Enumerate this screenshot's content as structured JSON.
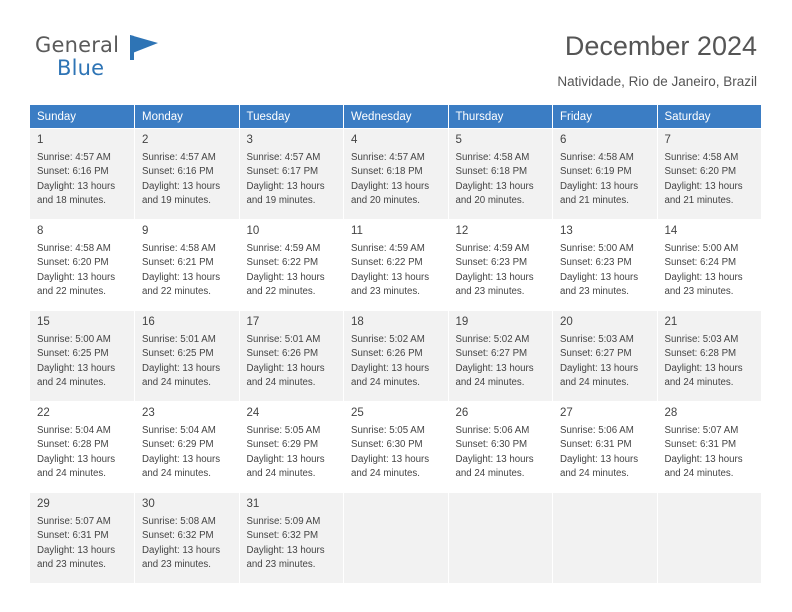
{
  "logo": {
    "word1": "General",
    "word2": "Blue",
    "flag_icon": "blue-flag-icon"
  },
  "header": {
    "title": "December 2024",
    "location": "Natividade, Rio de Janeiro, Brazil"
  },
  "calendar": {
    "weekdays": [
      "Sunday",
      "Monday",
      "Tuesday",
      "Wednesday",
      "Thursday",
      "Friday",
      "Saturday"
    ],
    "accent_color": "#3b7dc4",
    "shade_color": "#f2f2f2",
    "weeks": [
      [
        {
          "day": "1",
          "sunrise": "Sunrise: 4:57 AM",
          "sunset": "Sunset: 6:16 PM",
          "daylight1": "Daylight: 13 hours",
          "daylight2": "and 18 minutes."
        },
        {
          "day": "2",
          "sunrise": "Sunrise: 4:57 AM",
          "sunset": "Sunset: 6:16 PM",
          "daylight1": "Daylight: 13 hours",
          "daylight2": "and 19 minutes."
        },
        {
          "day": "3",
          "sunrise": "Sunrise: 4:57 AM",
          "sunset": "Sunset: 6:17 PM",
          "daylight1": "Daylight: 13 hours",
          "daylight2": "and 19 minutes."
        },
        {
          "day": "4",
          "sunrise": "Sunrise: 4:57 AM",
          "sunset": "Sunset: 6:18 PM",
          "daylight1": "Daylight: 13 hours",
          "daylight2": "and 20 minutes."
        },
        {
          "day": "5",
          "sunrise": "Sunrise: 4:58 AM",
          "sunset": "Sunset: 6:18 PM",
          "daylight1": "Daylight: 13 hours",
          "daylight2": "and 20 minutes."
        },
        {
          "day": "6",
          "sunrise": "Sunrise: 4:58 AM",
          "sunset": "Sunset: 6:19 PM",
          "daylight1": "Daylight: 13 hours",
          "daylight2": "and 21 minutes."
        },
        {
          "day": "7",
          "sunrise": "Sunrise: 4:58 AM",
          "sunset": "Sunset: 6:20 PM",
          "daylight1": "Daylight: 13 hours",
          "daylight2": "and 21 minutes."
        }
      ],
      [
        {
          "day": "8",
          "sunrise": "Sunrise: 4:58 AM",
          "sunset": "Sunset: 6:20 PM",
          "daylight1": "Daylight: 13 hours",
          "daylight2": "and 22 minutes."
        },
        {
          "day": "9",
          "sunrise": "Sunrise: 4:58 AM",
          "sunset": "Sunset: 6:21 PM",
          "daylight1": "Daylight: 13 hours",
          "daylight2": "and 22 minutes."
        },
        {
          "day": "10",
          "sunrise": "Sunrise: 4:59 AM",
          "sunset": "Sunset: 6:22 PM",
          "daylight1": "Daylight: 13 hours",
          "daylight2": "and 22 minutes."
        },
        {
          "day": "11",
          "sunrise": "Sunrise: 4:59 AM",
          "sunset": "Sunset: 6:22 PM",
          "daylight1": "Daylight: 13 hours",
          "daylight2": "and 23 minutes."
        },
        {
          "day": "12",
          "sunrise": "Sunrise: 4:59 AM",
          "sunset": "Sunset: 6:23 PM",
          "daylight1": "Daylight: 13 hours",
          "daylight2": "and 23 minutes."
        },
        {
          "day": "13",
          "sunrise": "Sunrise: 5:00 AM",
          "sunset": "Sunset: 6:23 PM",
          "daylight1": "Daylight: 13 hours",
          "daylight2": "and 23 minutes."
        },
        {
          "day": "14",
          "sunrise": "Sunrise: 5:00 AM",
          "sunset": "Sunset: 6:24 PM",
          "daylight1": "Daylight: 13 hours",
          "daylight2": "and 23 minutes."
        }
      ],
      [
        {
          "day": "15",
          "sunrise": "Sunrise: 5:00 AM",
          "sunset": "Sunset: 6:25 PM",
          "daylight1": "Daylight: 13 hours",
          "daylight2": "and 24 minutes."
        },
        {
          "day": "16",
          "sunrise": "Sunrise: 5:01 AM",
          "sunset": "Sunset: 6:25 PM",
          "daylight1": "Daylight: 13 hours",
          "daylight2": "and 24 minutes."
        },
        {
          "day": "17",
          "sunrise": "Sunrise: 5:01 AM",
          "sunset": "Sunset: 6:26 PM",
          "daylight1": "Daylight: 13 hours",
          "daylight2": "and 24 minutes."
        },
        {
          "day": "18",
          "sunrise": "Sunrise: 5:02 AM",
          "sunset": "Sunset: 6:26 PM",
          "daylight1": "Daylight: 13 hours",
          "daylight2": "and 24 minutes."
        },
        {
          "day": "19",
          "sunrise": "Sunrise: 5:02 AM",
          "sunset": "Sunset: 6:27 PM",
          "daylight1": "Daylight: 13 hours",
          "daylight2": "and 24 minutes."
        },
        {
          "day": "20",
          "sunrise": "Sunrise: 5:03 AM",
          "sunset": "Sunset: 6:27 PM",
          "daylight1": "Daylight: 13 hours",
          "daylight2": "and 24 minutes."
        },
        {
          "day": "21",
          "sunrise": "Sunrise: 5:03 AM",
          "sunset": "Sunset: 6:28 PM",
          "daylight1": "Daylight: 13 hours",
          "daylight2": "and 24 minutes."
        }
      ],
      [
        {
          "day": "22",
          "sunrise": "Sunrise: 5:04 AM",
          "sunset": "Sunset: 6:28 PM",
          "daylight1": "Daylight: 13 hours",
          "daylight2": "and 24 minutes."
        },
        {
          "day": "23",
          "sunrise": "Sunrise: 5:04 AM",
          "sunset": "Sunset: 6:29 PM",
          "daylight1": "Daylight: 13 hours",
          "daylight2": "and 24 minutes."
        },
        {
          "day": "24",
          "sunrise": "Sunrise: 5:05 AM",
          "sunset": "Sunset: 6:29 PM",
          "daylight1": "Daylight: 13 hours",
          "daylight2": "and 24 minutes."
        },
        {
          "day": "25",
          "sunrise": "Sunrise: 5:05 AM",
          "sunset": "Sunset: 6:30 PM",
          "daylight1": "Daylight: 13 hours",
          "daylight2": "and 24 minutes."
        },
        {
          "day": "26",
          "sunrise": "Sunrise: 5:06 AM",
          "sunset": "Sunset: 6:30 PM",
          "daylight1": "Daylight: 13 hours",
          "daylight2": "and 24 minutes."
        },
        {
          "day": "27",
          "sunrise": "Sunrise: 5:06 AM",
          "sunset": "Sunset: 6:31 PM",
          "daylight1": "Daylight: 13 hours",
          "daylight2": "and 24 minutes."
        },
        {
          "day": "28",
          "sunrise": "Sunrise: 5:07 AM",
          "sunset": "Sunset: 6:31 PM",
          "daylight1": "Daylight: 13 hours",
          "daylight2": "and 24 minutes."
        }
      ],
      [
        {
          "day": "29",
          "sunrise": "Sunrise: 5:07 AM",
          "sunset": "Sunset: 6:31 PM",
          "daylight1": "Daylight: 13 hours",
          "daylight2": "and 23 minutes."
        },
        {
          "day": "30",
          "sunrise": "Sunrise: 5:08 AM",
          "sunset": "Sunset: 6:32 PM",
          "daylight1": "Daylight: 13 hours",
          "daylight2": "and 23 minutes."
        },
        {
          "day": "31",
          "sunrise": "Sunrise: 5:09 AM",
          "sunset": "Sunset: 6:32 PM",
          "daylight1": "Daylight: 13 hours",
          "daylight2": "and 23 minutes."
        },
        {
          "day": "",
          "sunrise": "",
          "sunset": "",
          "daylight1": "",
          "daylight2": ""
        },
        {
          "day": "",
          "sunrise": "",
          "sunset": "",
          "daylight1": "",
          "daylight2": ""
        },
        {
          "day": "",
          "sunrise": "",
          "sunset": "",
          "daylight1": "",
          "daylight2": ""
        },
        {
          "day": "",
          "sunrise": "",
          "sunset": "",
          "daylight1": "",
          "daylight2": ""
        }
      ]
    ]
  }
}
